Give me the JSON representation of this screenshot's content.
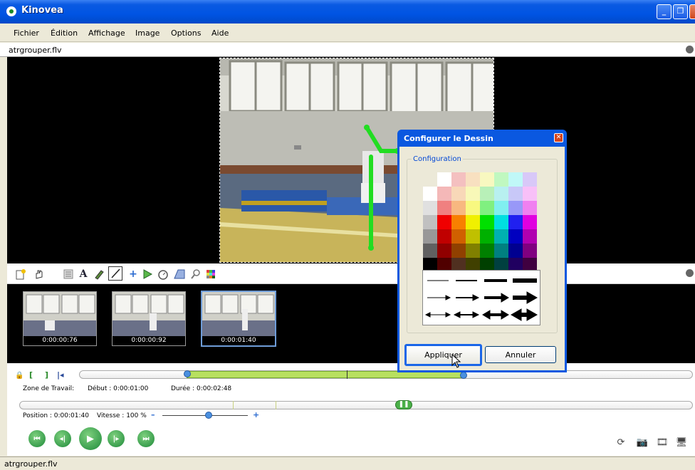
{
  "window": {
    "title": "Kinovea",
    "buttons": {
      "minimize": "_",
      "restore": "❐",
      "close": "✕"
    }
  },
  "menu": [
    "Fichier",
    "Édition",
    "Affichage",
    "Image",
    "Options",
    "Aide"
  ],
  "file_label": "atrgrouper.flv",
  "thumbnails": [
    {
      "time": "0:00:00:76"
    },
    {
      "time": "0:00:00:92"
    },
    {
      "time": "0:00:01:40"
    }
  ],
  "controls": {
    "workzone_label": "Zone de Travail:",
    "debut": "Début : 0:00:01:00",
    "duree": "Durée : 0:00:02:48",
    "position": "Position : 0:00:01:40",
    "vitesse": "Vitesse : 100 %",
    "speed_percent": 100
  },
  "statusbar": "atrgrouper.flv",
  "dialog": {
    "title": "Configurer le Dessin",
    "close": "✕",
    "group_label": "Configuration",
    "apply": "Appliquer",
    "cancel": "Annuler"
  },
  "palette": [
    [
      "#ffffff",
      "#f4b8b8",
      "#f8d8b8",
      "#f8f8b8",
      "#b8f0b8",
      "#b8f0f0",
      "#c8c8f8"
    ],
    [
      "#e0e0e0",
      "#f08080",
      "#f8b880",
      "#f8f880",
      "#80f080",
      "#80f0f0",
      "#9898f8"
    ],
    [
      "#c0c0c0",
      "#f00000",
      "#f88000",
      "#f0f000",
      "#00e000",
      "#00e0e0",
      "#2020f0"
    ],
    [
      "#989898",
      "#c00000",
      "#d06000",
      "#c0c000",
      "#00b000",
      "#00b0b0",
      "#0000c0"
    ],
    [
      "#606060",
      "#900000",
      "#904000",
      "#808000",
      "#008000",
      "#008080",
      "#000090"
    ],
    [
      "#000000",
      "#500000",
      "#503020",
      "#404000",
      "#004000",
      "#004040",
      "#200060"
    ]
  ],
  "palette_top_row": [
    "#ffffff",
    "#f4c0c0",
    "#f8e0c0",
    "#f8f8c0",
    "#c0f8c0",
    "#c0f8f8",
    "#d8c8f8"
  ],
  "palette_right_col": [
    "#f8c0f8",
    "#f080f0",
    "#e000e0",
    "#b000b0",
    "#800080",
    "#400040"
  ]
}
